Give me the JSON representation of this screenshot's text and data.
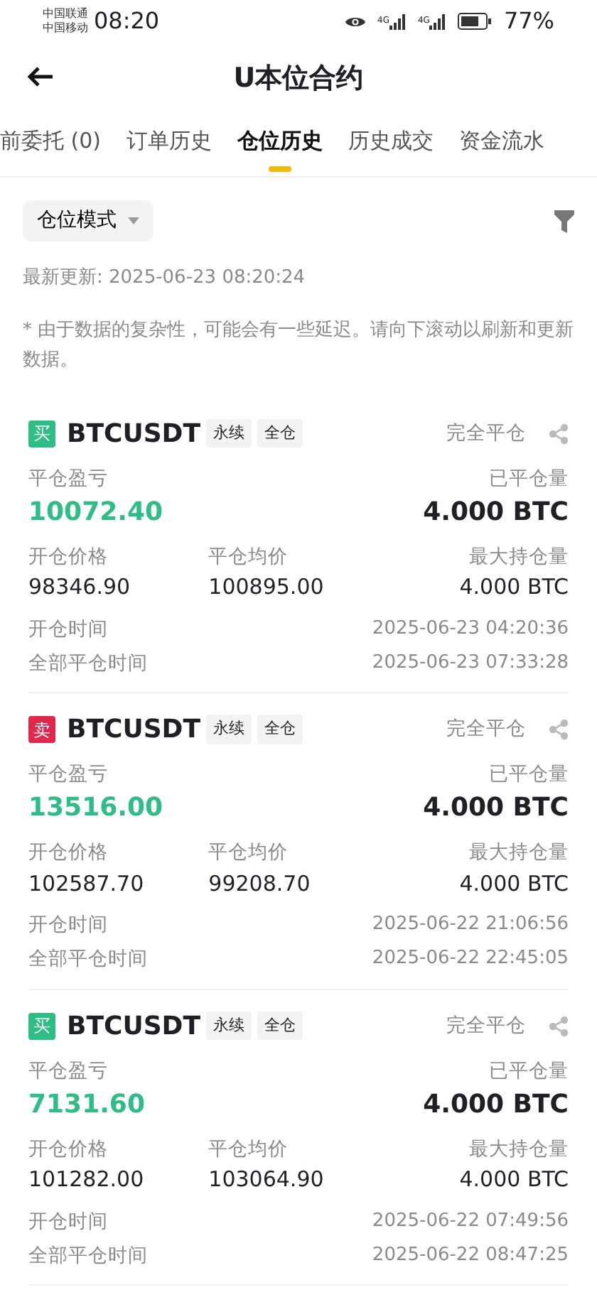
{
  "status_bar": {
    "carriers": [
      "中国联通",
      "中国移动"
    ],
    "time": "08:20",
    "network_labels": [
      "4G",
      "4G"
    ],
    "battery": "77%"
  },
  "header": {
    "title": "U本位合约"
  },
  "tabs": [
    {
      "label": "前委托 (0)",
      "selected": false
    },
    {
      "label": "订单历史",
      "selected": false
    },
    {
      "label": "仓位历史",
      "selected": true
    },
    {
      "label": "历史成交",
      "selected": false
    },
    {
      "label": "资金流水",
      "selected": false
    }
  ],
  "filter": {
    "mode": "仓位模式"
  },
  "last_update": "最新更新: 2025-06-23 08:20:24",
  "note": "* 由于数据的复杂性，可能会有一些延迟。请向下滚动以刷新和更新数据。",
  "positions": [
    {
      "kind": "buy",
      "side_label": "买",
      "symbol": "BTCUSDT",
      "tags": [
        "永续",
        "全仓"
      ],
      "status": "完全平仓",
      "pnl_label": "平仓盈亏",
      "pnl": "10072.40",
      "closed_label": "已平仓量",
      "closed": "4.000 BTC",
      "open_price_label": "开仓价格",
      "open_price": "98346.90",
      "close_avg_label": "平仓均价",
      "close_avg": "100895.00",
      "max_label": "最大持仓量",
      "max": "4.000 BTC",
      "open_time_label": "开仓时间",
      "open_time": "2025-06-23 04:20:36",
      "close_time_label": "全部平仓时间",
      "close_time": "2025-06-23 07:33:28"
    },
    {
      "kind": "sell",
      "side_label": "卖",
      "symbol": "BTCUSDT",
      "tags": [
        "永续",
        "全仓"
      ],
      "status": "完全平仓",
      "pnl_label": "平仓盈亏",
      "pnl": "13516.00",
      "closed_label": "已平仓量",
      "closed": "4.000 BTC",
      "open_price_label": "开仓价格",
      "open_price": "102587.70",
      "close_avg_label": "平仓均价",
      "close_avg": "99208.70",
      "max_label": "最大持仓量",
      "max": "4.000 BTC",
      "open_time_label": "开仓时间",
      "open_time": "2025-06-22 21:06:56",
      "close_time_label": "全部平仓时间",
      "close_time": "2025-06-22 22:45:05"
    },
    {
      "kind": "buy",
      "side_label": "买",
      "symbol": "BTCUSDT",
      "tags": [
        "永续",
        "全仓"
      ],
      "status": "完全平仓",
      "pnl_label": "平仓盈亏",
      "pnl": "7131.60",
      "closed_label": "已平仓量",
      "closed": "4.000 BTC",
      "open_price_label": "开仓价格",
      "open_price": "101282.00",
      "close_avg_label": "平仓均价",
      "close_avg": "103064.90",
      "max_label": "最大持仓量",
      "max": "4.000 BTC",
      "open_time_label": "开仓时间",
      "open_time": "2025-06-22 07:49:56",
      "close_time_label": "全部平仓时间",
      "close_time": "2025-06-22 08:47:25"
    }
  ]
}
